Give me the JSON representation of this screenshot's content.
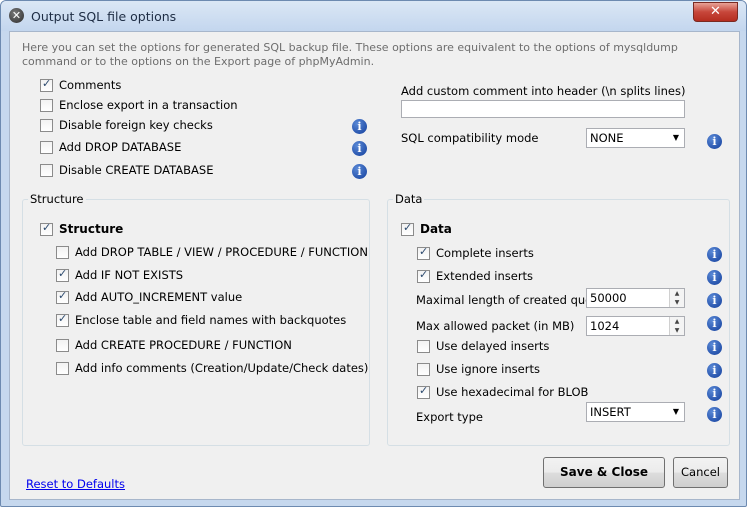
{
  "window": {
    "title": "Output SQL file options",
    "close_label": "✕"
  },
  "description": "Here you can set the options for generated SQL backup file. These options are equivalent to the options of mysqldump command or to the options on the Export page of phpMyAdmin.",
  "general": {
    "comments": {
      "label": "Comments",
      "checked": true
    },
    "transaction": {
      "label": "Enclose export in a transaction",
      "checked": false
    },
    "fk_checks": {
      "label": "Disable foreign key checks",
      "checked": false
    },
    "drop_db": {
      "label": "Add DROP DATABASE",
      "checked": false
    },
    "create_db": {
      "label": "Disable CREATE DATABASE",
      "checked": false
    }
  },
  "header_comment": {
    "label": "Add custom comment into header (\\n splits lines)",
    "value": ""
  },
  "compat": {
    "label": "SQL compatibility mode",
    "value": "NONE"
  },
  "structure": {
    "group_label": "Structure",
    "main": {
      "label": "Structure",
      "checked": true
    },
    "drop_table": {
      "label": "Add DROP TABLE / VIEW / PROCEDURE / FUNCTION",
      "checked": false
    },
    "if_not_exists": {
      "label": "Add IF NOT EXISTS",
      "checked": true
    },
    "auto_increment": {
      "label": "Add AUTO_INCREMENT value",
      "checked": true
    },
    "backquotes": {
      "label": "Enclose table and field names with backquotes",
      "checked": true
    },
    "create_proc": {
      "label": "Add CREATE PROCEDURE / FUNCTION",
      "checked": false
    },
    "info_comments": {
      "label": "Add info comments (Creation/Update/Check dates)",
      "checked": false
    }
  },
  "data": {
    "group_label": "Data",
    "main": {
      "label": "Data",
      "checked": true
    },
    "complete_inserts": {
      "label": "Complete inserts",
      "checked": true
    },
    "extended_inserts": {
      "label": "Extended inserts",
      "checked": true
    },
    "max_query": {
      "label": "Maximal length of created query",
      "value": "50000"
    },
    "max_packet": {
      "label": "Max allowed packet (in MB)",
      "value": "1024"
    },
    "delayed": {
      "label": "Use delayed inserts",
      "checked": false
    },
    "ignore": {
      "label": "Use ignore inserts",
      "checked": false
    },
    "hex_blob": {
      "label": "Use hexadecimal for BLOB",
      "checked": true
    },
    "export_type": {
      "label": "Export type",
      "value": "INSERT"
    }
  },
  "buttons": {
    "reset": "Reset to Defaults",
    "save": "Save & Close",
    "cancel": "Cancel"
  },
  "icons": {
    "info": "i",
    "arrow": "▼",
    "up": "▲",
    "down": "▼"
  }
}
